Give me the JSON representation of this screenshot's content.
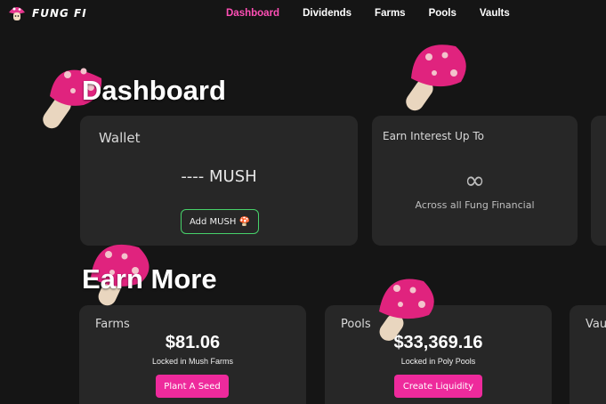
{
  "nav": {
    "brand": "FUNG FI",
    "links": [
      {
        "label": "Dashboard",
        "active": true
      },
      {
        "label": "Dividends",
        "active": false
      },
      {
        "label": "Farms",
        "active": false
      },
      {
        "label": "Pools",
        "active": false
      },
      {
        "label": "Vaults",
        "active": false
      }
    ]
  },
  "dashboard": {
    "title": "Dashboard",
    "wallet": {
      "title": "Wallet",
      "amount": "---- MUSH",
      "button": "Add MUSH 🍄"
    },
    "interest": {
      "title": "Earn Interest Up To",
      "value": "∞",
      "caption": "Across all Fung Financial"
    }
  },
  "earn_more": {
    "title": "Earn More",
    "farms": {
      "title": "Farms",
      "value": "$81.06",
      "caption": "Locked in Mush Farms",
      "button": "Plant A Seed"
    },
    "pools": {
      "title": "Pools",
      "value": "$33,369.16",
      "caption": "Locked in Poly Pools",
      "button": "Create Liquidity"
    },
    "vaults": {
      "title": "Vau"
    }
  },
  "colors": {
    "accent_pink": "#ff4fb6",
    "button_pink": "#ee2a9c",
    "outline_green": "#47d16a",
    "background": "#151515",
    "card": "#272727"
  }
}
